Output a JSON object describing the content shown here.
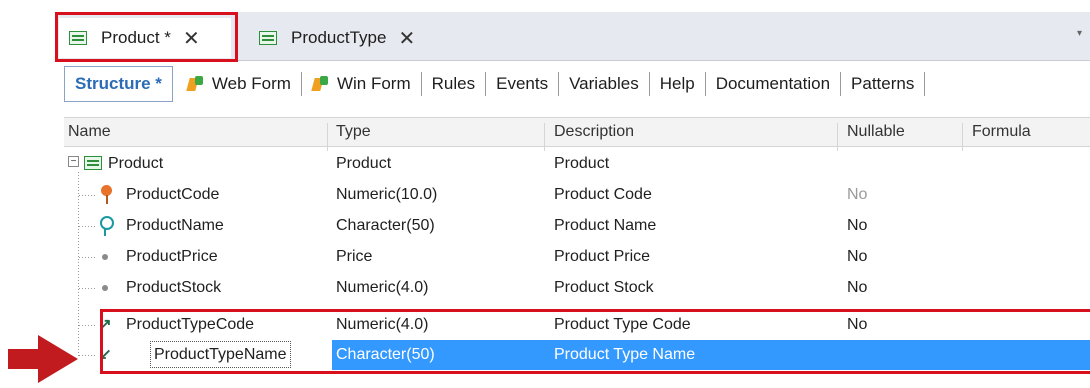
{
  "doc_tabs": [
    {
      "label": "Product *",
      "close": "✕"
    },
    {
      "label": "ProductType",
      "close": "✕"
    }
  ],
  "overflow_glyph": "▾",
  "editor_tabs": [
    "Structure *",
    "Web Form",
    "Win Form",
    "Rules",
    "Events",
    "Variables",
    "Help",
    "Documentation",
    "Patterns"
  ],
  "columns": [
    "Name",
    "Type",
    "Description",
    "Nullable",
    "Formula"
  ],
  "rows": [
    {
      "name": "Product",
      "type": "Product",
      "description": "Product",
      "nullable": "",
      "icon": "transaction-icon"
    },
    {
      "name": "ProductCode",
      "type": "Numeric(10.0)",
      "description": "Product Code",
      "nullable": "No",
      "icon": "primary-key-icon"
    },
    {
      "name": "ProductName",
      "type": "Character(50)",
      "description": "Product Name",
      "nullable": "No",
      "icon": "description-key-icon"
    },
    {
      "name": "ProductPrice",
      "type": "Price",
      "description": "Product Price",
      "nullable": "No",
      "icon": "attribute-dot-icon"
    },
    {
      "name": "ProductStock",
      "type": "Numeric(4.0)",
      "description": "Product Stock",
      "nullable": "No",
      "icon": "attribute-dot-icon"
    },
    {
      "name": "ProductTypeCode",
      "type": "Numeric(4.0)",
      "description": "Product Type Code",
      "nullable": "No",
      "icon": "foreign-key-icon"
    },
    {
      "name": "ProductTypeName",
      "type": "Character(50)",
      "description": "Product Type Name",
      "nullable": "",
      "icon": "inferred-attribute-icon"
    }
  ],
  "glyphs": {
    "expander": "−",
    "arrow_ne": "↗",
    "arrow_sw": "↙"
  },
  "colors": {
    "highlight_red": "#d8101e",
    "selection_blue": "#3399ff",
    "active_tab_blue": "#2b6cb7"
  }
}
